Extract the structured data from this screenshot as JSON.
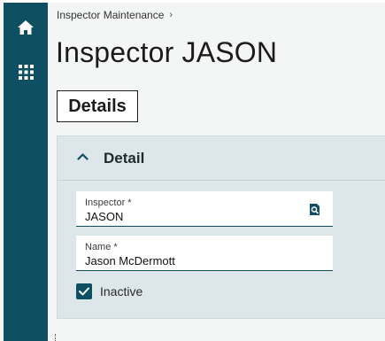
{
  "nav": {
    "home_icon": "home-icon",
    "apps_icon": "apps-grid-icon",
    "rail_color": "#0e4f61"
  },
  "breadcrumb": {
    "item": "Inspector Maintenance",
    "separator": "›"
  },
  "page": {
    "title": "Inspector JASON"
  },
  "tabs": [
    {
      "label": "Details",
      "active": true
    }
  ],
  "detail_panel": {
    "title": "Detail",
    "expanded": true,
    "fields": {
      "inspector": {
        "label": "Inspector *",
        "value": "JASON",
        "lookup_icon": "search-lookup-icon"
      },
      "name": {
        "label": "Name *",
        "value": "Jason McDermott"
      }
    },
    "inactive": {
      "label": "Inactive",
      "checked": true
    }
  }
}
